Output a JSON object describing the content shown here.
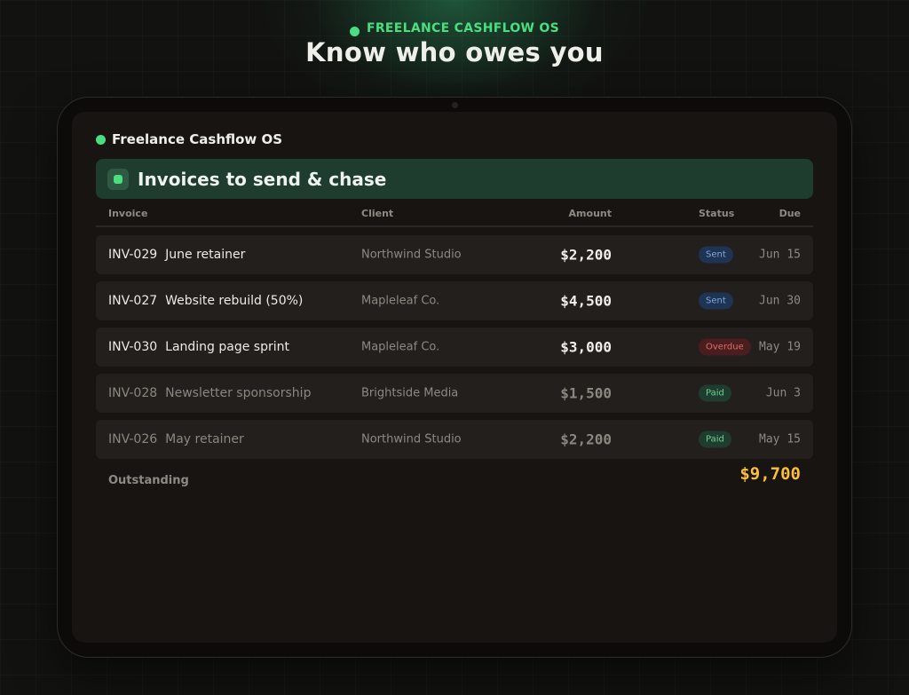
{
  "hero": {
    "eyebrow": "FREELANCE CASHFLOW OS",
    "title": "Know who owes you"
  },
  "app": {
    "name": "Freelance Cashflow OS",
    "section_title": "Invoices to send & chase"
  },
  "table": {
    "columns": {
      "invoice": "Invoice",
      "client": "Client",
      "amount": "Amount",
      "status": "Status",
      "due": "Due"
    },
    "rows": [
      {
        "code": "INV-029",
        "desc": "June retainer",
        "client": "Northwind Studio",
        "amount": "$2,200",
        "status": "Sent",
        "due": "Jun 15"
      },
      {
        "code": "INV-027",
        "desc": "Website rebuild (50%)",
        "client": "Mapleleaf Co.",
        "amount": "$4,500",
        "status": "Sent",
        "due": "Jun 30"
      },
      {
        "code": "INV-030",
        "desc": "Landing page sprint",
        "client": "Mapleleaf Co.",
        "amount": "$3,000",
        "status": "Overdue",
        "due": "May 19"
      },
      {
        "code": "INV-028",
        "desc": "Newsletter sponsorship",
        "client": "Brightside Media",
        "amount": "$1,500",
        "status": "Paid",
        "due": "Jun 3"
      },
      {
        "code": "INV-026",
        "desc": "May retainer",
        "client": "Northwind Studio",
        "amount": "$2,200",
        "status": "Paid",
        "due": "May 15"
      }
    ]
  },
  "summary": {
    "label": "Outstanding",
    "total": "$9,700"
  },
  "colors": {
    "accent": "#4ade80",
    "total": "#fbbf3a",
    "sent": "#7fa8dc",
    "overdue": "#e06a6a",
    "paid": "#6fcf93"
  }
}
